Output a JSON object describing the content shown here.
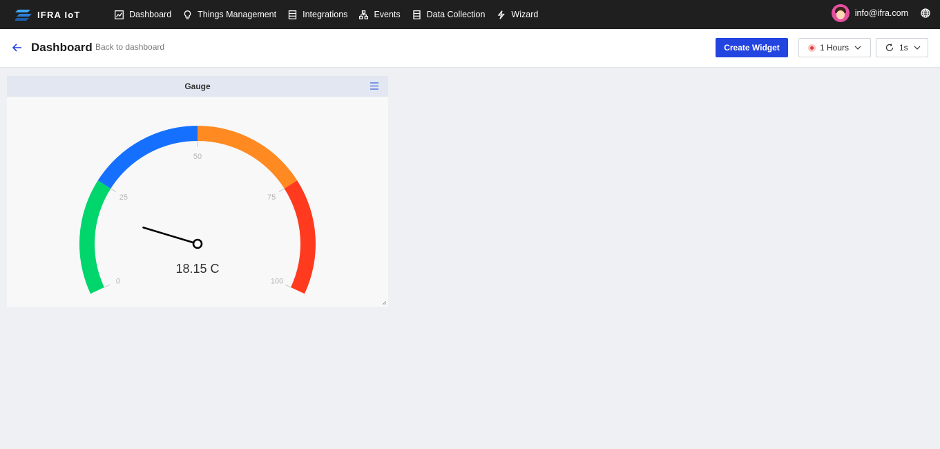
{
  "brand": {
    "name": "IFRA IoT"
  },
  "nav": {
    "items": [
      {
        "label": "Dashboard",
        "icon": "chart-line-icon"
      },
      {
        "label": "Things Management",
        "icon": "lightbulb-icon"
      },
      {
        "label": "Integrations",
        "icon": "server-icon"
      },
      {
        "label": "Events",
        "icon": "sitemap-icon"
      },
      {
        "label": "Data Collection",
        "icon": "database-icon"
      },
      {
        "label": "Wizard",
        "icon": "bolt-icon"
      }
    ]
  },
  "user": {
    "email": "info@ifra.com"
  },
  "header": {
    "title": "Dashboard",
    "back_label": "Back to dashboard",
    "create_button": "Create Widget",
    "time_range": "1 Hours",
    "refresh_interval": "1s"
  },
  "widget": {
    "title": "Gauge",
    "value_text": "18.15 C",
    "gauge": {
      "value": 18.15,
      "min": 0,
      "max": 100,
      "ticks": [
        "0",
        "25",
        "50",
        "75",
        "100"
      ],
      "bands": [
        {
          "from": 0,
          "to": 25,
          "color": "#00d66b"
        },
        {
          "from": 25,
          "to": 50,
          "color": "#1670ff"
        },
        {
          "from": 50,
          "to": 75,
          "color": "#ff8a22"
        },
        {
          "from": 75,
          "to": 100,
          "color": "#ff3a1e"
        }
      ]
    }
  },
  "colors": {
    "topbar": "#1f1f1f",
    "accent": "#2244e0",
    "page_bg": "#eef0f4"
  }
}
